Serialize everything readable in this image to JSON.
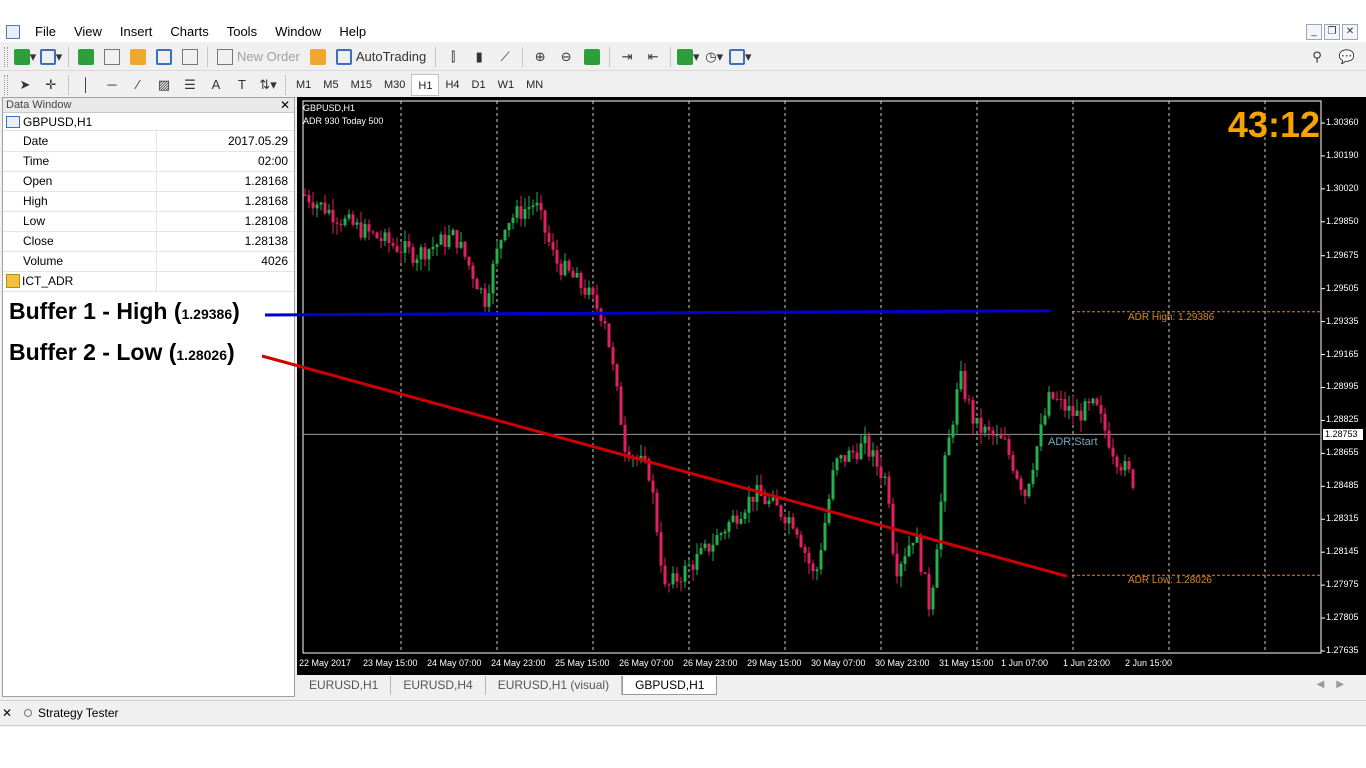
{
  "menubar": {
    "items": [
      "File",
      "View",
      "Insert",
      "Charts",
      "Tools",
      "Window",
      "Help"
    ]
  },
  "toolbar": {
    "new_order_label": "New Order",
    "autotrading_label": "AutoTrading",
    "timeframes": [
      "M1",
      "M5",
      "M15",
      "M30",
      "H1",
      "H4",
      "D1",
      "W1",
      "MN"
    ],
    "active_timeframe": "H1"
  },
  "data_window": {
    "title": "Data Window",
    "symbol": "GBPUSD,H1",
    "rows": [
      {
        "key": "Date",
        "value": "2017.05.29"
      },
      {
        "key": "Time",
        "value": "02:00"
      },
      {
        "key": "Open",
        "value": "1.28168"
      },
      {
        "key": "High",
        "value": "1.28168"
      },
      {
        "key": "Low",
        "value": "1.28108"
      },
      {
        "key": "Close",
        "value": "1.28138"
      },
      {
        "key": "Volume",
        "value": "4026"
      }
    ],
    "indicator": "ICT_ADR"
  },
  "annotations": {
    "buffer1_text": "Buffer 1 - High (",
    "buffer1_value": "1.29386",
    "buffer1_close": ")",
    "buffer2_text": "Buffer 2 - Low (",
    "buffer2_value": "1.28026",
    "buffer2_close": ")",
    "buffer1_color": "#0000cc",
    "buffer2_color": "#cc0000"
  },
  "chart": {
    "symbol_line": "GBPUSD,H1",
    "indicator_line": "ADR 930  Today 500",
    "timer": "43:12",
    "adr_high_label": "ADR High: 1.29386",
    "adr_low_label": "ADR Low: 1.28026",
    "adr_start_label": "ADR Start",
    "current_price": "1.28753",
    "price_ticks": [
      "1.30360",
      "1.30190",
      "1.30020",
      "1.29850",
      "1.29675",
      "1.29505",
      "1.29335",
      "1.29165",
      "1.28995",
      "1.28825",
      "1.28655",
      "1.28485",
      "1.28315",
      "1.28145",
      "1.27975",
      "1.27805",
      "1.27635"
    ],
    "time_ticks": [
      "22 May 2017",
      "23 May 15:00",
      "24 May 07:00",
      "24 May 23:00",
      "25 May 15:00",
      "26 May 07:00",
      "26 May 23:00",
      "29 May 15:00",
      "30 May 07:00",
      "30 May 23:00",
      "31 May 15:00",
      "1 Jun 07:00",
      "1 Jun 23:00",
      "2 Jun 15:00"
    ],
    "colors": {
      "background": "#000000",
      "bull": "#22b14c",
      "bear": "#e0215f",
      "timer": "#f6a200",
      "adr": "#d58a1c"
    }
  },
  "tabs": {
    "items": [
      "EURUSD,H1",
      "EURUSD,H4",
      "EURUSD,H1 (visual)",
      "GBPUSD,H1"
    ],
    "active": "GBPUSD,H1"
  },
  "tester": {
    "label": "Strategy Tester"
  }
}
